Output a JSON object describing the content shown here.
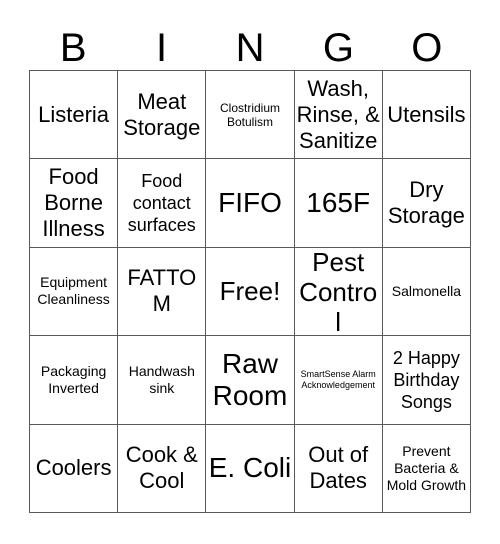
{
  "header": {
    "letters": [
      "B",
      "I",
      "N",
      "G",
      "O"
    ]
  },
  "grid": {
    "rows": [
      {
        "cells": [
          {
            "text": "Listeria",
            "size": "xl"
          },
          {
            "text": "Meat Storage",
            "size": "xl"
          },
          {
            "text": "Clostridium Botulism",
            "size": "sm"
          },
          {
            "text": "Wash, Rinse, & Sanitize",
            "size": "xl"
          },
          {
            "text": "Utensils",
            "size": "xl"
          }
        ]
      },
      {
        "cells": [
          {
            "text": "Food Borne Illness",
            "size": "xl"
          },
          {
            "text": "Food contact surfaces",
            "size": "lg"
          },
          {
            "text": "FIFO",
            "size": "huge"
          },
          {
            "text": "165F",
            "size": "huge"
          },
          {
            "text": "Dry Storage",
            "size": "xl"
          }
        ]
      },
      {
        "cells": [
          {
            "text": "Equipment Cleanliness",
            "size": "md"
          },
          {
            "text": "FATTOM",
            "size": "xl"
          },
          {
            "text": "Free!",
            "size": "xxl"
          },
          {
            "text": "Pest Control",
            "size": "xxl"
          },
          {
            "text": "Salmonella",
            "size": "md"
          }
        ]
      },
      {
        "cells": [
          {
            "text": "Packaging Inverted",
            "size": "md"
          },
          {
            "text": "Handwash sink",
            "size": "md"
          },
          {
            "text": "Raw Room",
            "size": "huge"
          },
          {
            "text": "SmartSense Alarm Acknowledgement",
            "size": "xs"
          },
          {
            "text": "2 Happy Birthday Songs",
            "size": "lg"
          }
        ]
      },
      {
        "cells": [
          {
            "text": "Coolers",
            "size": "xl"
          },
          {
            "text": "Cook & Cool",
            "size": "xl"
          },
          {
            "text": "E. Coli",
            "size": "huge"
          },
          {
            "text": "Out of Dates",
            "size": "xl"
          },
          {
            "text": "Prevent Bacteria & Mold Growth",
            "size": "md"
          }
        ]
      }
    ]
  },
  "colors": {
    "background": "#ffffff",
    "text": "#000000",
    "border": "#595959"
  }
}
